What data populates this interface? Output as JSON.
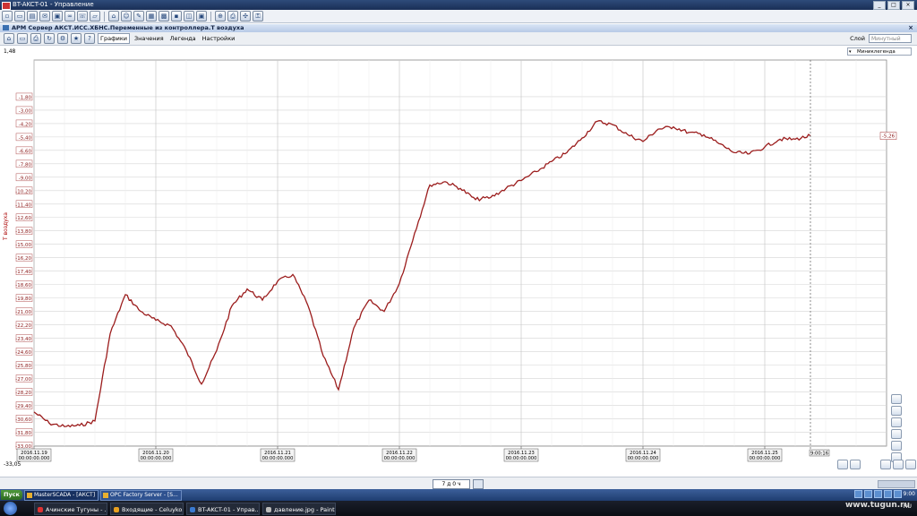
{
  "window": {
    "title": "BT-AKCT-01 - Управление",
    "document_title": "АРМ Сервер АКСТ.ИСС.ХБНС.Переменные из контроллера.Т воздуха"
  },
  "chart_toolbar": {
    "tabs": [
      "Графики",
      "Значения",
      "Легенда",
      "Настройки"
    ],
    "active_tab": "Графики",
    "layer_label": "Слой",
    "layer_value": "Минутный",
    "legend_dropdown": "Миниклегенда"
  },
  "chart_data": {
    "type": "line",
    "ylabel": "Т воздуха",
    "y_top_label": "1,48",
    "y_bottom_label": "-33,05",
    "ylim": [
      -33.05,
      1.48
    ],
    "y_ticks": [
      "-1,80",
      "-3,00",
      "-4,20",
      "-5,40",
      "-6,60",
      "-7,80",
      "-9,00",
      "-10,20",
      "-11,40",
      "-12,60",
      "-13,80",
      "-15,00",
      "-16,20",
      "-17,40",
      "-18,60",
      "-19,80",
      "-21,00",
      "-22,20",
      "-23,40",
      "-24,60",
      "-25,80",
      "-27,00",
      "-28,20",
      "-29,40",
      "-30,60",
      "-31,80",
      "-33,00"
    ],
    "x_ticks": [
      {
        "date": "2016.11.19",
        "time": "00:00:00.000"
      },
      {
        "date": "2016.11.20",
        "time": "00:00:00.000"
      },
      {
        "date": "2016.11.21",
        "time": "00:00:00.000"
      },
      {
        "date": "2016.11.22",
        "time": "00:00:00.000"
      },
      {
        "date": "2016.11.23",
        "time": "00:00:00.000"
      },
      {
        "date": "2016.11.24",
        "time": "00:00:00.000"
      },
      {
        "date": "2016.11.25",
        "time": "00:00:00.000"
      }
    ],
    "current_time_label": "9:00:16",
    "current_value_label": "-5,26",
    "line_color": "#9b1c1c",
    "grid": true,
    "series": [
      {
        "x": [
          "2016-11-19 00:00",
          "2016-11-19 03:00",
          "2016-11-19 06:00",
          "2016-11-19 09:00",
          "2016-11-19 12:00",
          "2016-11-19 15:00",
          "2016-11-19 18:00",
          "2016-11-19 21:00",
          "2016-11-20 00:00",
          "2016-11-20 03:00",
          "2016-11-20 06:00",
          "2016-11-20 09:00",
          "2016-11-20 12:00",
          "2016-11-20 15:00",
          "2016-11-20 18:00",
          "2016-11-20 21:00",
          "2016-11-21 00:00",
          "2016-11-21 03:00",
          "2016-11-21 06:00",
          "2016-11-21 09:00",
          "2016-11-21 12:00",
          "2016-11-21 15:00",
          "2016-11-21 18:00",
          "2016-11-21 21:00",
          "2016-11-22 00:00",
          "2016-11-22 03:00",
          "2016-11-22 06:00",
          "2016-11-22 09:00",
          "2016-11-22 12:00",
          "2016-11-22 15:00",
          "2016-11-22 18:00",
          "2016-11-22 21:00",
          "2016-11-23 00:00",
          "2016-11-23 03:00",
          "2016-11-23 06:00",
          "2016-11-23 09:00",
          "2016-11-23 12:00",
          "2016-11-23 15:00",
          "2016-11-23 18:00",
          "2016-11-23 21:00",
          "2016-11-24 00:00",
          "2016-11-24 03:00",
          "2016-11-24 06:00",
          "2016-11-24 09:00",
          "2016-11-24 12:00",
          "2016-11-24 15:00",
          "2016-11-24 18:00",
          "2016-11-24 21:00",
          "2016-11-25 00:00",
          "2016-11-25 03:00",
          "2016-11-25 06:00",
          "2016-11-25 09:00"
        ],
        "values": [
          -30.0,
          -31.0,
          -31.3,
          -31.2,
          -30.8,
          -23.0,
          -19.5,
          -21.0,
          -21.8,
          -22.3,
          -24.5,
          -27.5,
          -24.5,
          -20.5,
          -19.0,
          -20.0,
          -18.3,
          -17.7,
          -20.5,
          -25.0,
          -28.0,
          -22.5,
          -20.0,
          -21.0,
          -18.5,
          -14.0,
          -9.7,
          -9.4,
          -10.0,
          -11.0,
          -10.8,
          -10.0,
          -9.3,
          -8.5,
          -7.6,
          -6.8,
          -5.5,
          -4.0,
          -4.3,
          -5.2,
          -5.8,
          -4.7,
          -4.5,
          -5.0,
          -5.2,
          -6.0,
          -6.8,
          -6.9,
          -6.3,
          -5.6,
          -5.6,
          -5.3
        ]
      }
    ]
  },
  "status": {
    "scale": "7 д 0 ч"
  },
  "taskbar_apps": [
    {
      "label": "MasterSCADA - [АКСТ]",
      "active": true
    },
    {
      "label": "OPC Factory Server - [S...",
      "active": false
    }
  ],
  "taskbar_windows": [
    {
      "label": "Ачинские Тугуны - ..."
    },
    {
      "label": "Входящие - Celuyko..."
    },
    {
      "label": "BT-AKCT-01 - Управ..."
    },
    {
      "label": "давление.jpg - Paint"
    }
  ],
  "start_label": "Пуск",
  "tray": {
    "lang": "RU",
    "time": "9:00",
    "watermark": "www.tugun.ru"
  }
}
